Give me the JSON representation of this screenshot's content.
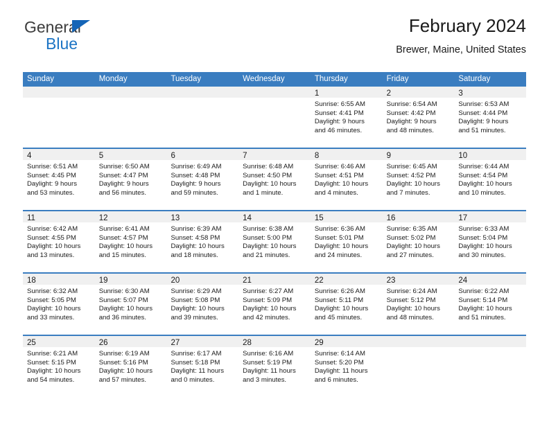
{
  "brand": {
    "name_primary": "General",
    "name_secondary": "Blue",
    "triangle_icon": "triangle-icon",
    "accent_color": "#1c74c4"
  },
  "header": {
    "title": "February 2024",
    "subtitle": "Brewer, Maine, United States"
  },
  "calendar": {
    "header_bg": "#3a7dc0",
    "day_head_bg": "#f0f0f0",
    "weekdays": [
      "Sunday",
      "Monday",
      "Tuesday",
      "Wednesday",
      "Thursday",
      "Friday",
      "Saturday"
    ],
    "weeks": [
      [
        {
          "day": "",
          "sunrise": "",
          "sunset": "",
          "daylight1": "",
          "daylight2": ""
        },
        {
          "day": "",
          "sunrise": "",
          "sunset": "",
          "daylight1": "",
          "daylight2": ""
        },
        {
          "day": "",
          "sunrise": "",
          "sunset": "",
          "daylight1": "",
          "daylight2": ""
        },
        {
          "day": "",
          "sunrise": "",
          "sunset": "",
          "daylight1": "",
          "daylight2": ""
        },
        {
          "day": "1",
          "sunrise": "Sunrise: 6:55 AM",
          "sunset": "Sunset: 4:41 PM",
          "daylight1": "Daylight: 9 hours",
          "daylight2": "and 46 minutes."
        },
        {
          "day": "2",
          "sunrise": "Sunrise: 6:54 AM",
          "sunset": "Sunset: 4:42 PM",
          "daylight1": "Daylight: 9 hours",
          "daylight2": "and 48 minutes."
        },
        {
          "day": "3",
          "sunrise": "Sunrise: 6:53 AM",
          "sunset": "Sunset: 4:44 PM",
          "daylight1": "Daylight: 9 hours",
          "daylight2": "and 51 minutes."
        }
      ],
      [
        {
          "day": "4",
          "sunrise": "Sunrise: 6:51 AM",
          "sunset": "Sunset: 4:45 PM",
          "daylight1": "Daylight: 9 hours",
          "daylight2": "and 53 minutes."
        },
        {
          "day": "5",
          "sunrise": "Sunrise: 6:50 AM",
          "sunset": "Sunset: 4:47 PM",
          "daylight1": "Daylight: 9 hours",
          "daylight2": "and 56 minutes."
        },
        {
          "day": "6",
          "sunrise": "Sunrise: 6:49 AM",
          "sunset": "Sunset: 4:48 PM",
          "daylight1": "Daylight: 9 hours",
          "daylight2": "and 59 minutes."
        },
        {
          "day": "7",
          "sunrise": "Sunrise: 6:48 AM",
          "sunset": "Sunset: 4:50 PM",
          "daylight1": "Daylight: 10 hours",
          "daylight2": "and 1 minute."
        },
        {
          "day": "8",
          "sunrise": "Sunrise: 6:46 AM",
          "sunset": "Sunset: 4:51 PM",
          "daylight1": "Daylight: 10 hours",
          "daylight2": "and 4 minutes."
        },
        {
          "day": "9",
          "sunrise": "Sunrise: 6:45 AM",
          "sunset": "Sunset: 4:52 PM",
          "daylight1": "Daylight: 10 hours",
          "daylight2": "and 7 minutes."
        },
        {
          "day": "10",
          "sunrise": "Sunrise: 6:44 AM",
          "sunset": "Sunset: 4:54 PM",
          "daylight1": "Daylight: 10 hours",
          "daylight2": "and 10 minutes."
        }
      ],
      [
        {
          "day": "11",
          "sunrise": "Sunrise: 6:42 AM",
          "sunset": "Sunset: 4:55 PM",
          "daylight1": "Daylight: 10 hours",
          "daylight2": "and 13 minutes."
        },
        {
          "day": "12",
          "sunrise": "Sunrise: 6:41 AM",
          "sunset": "Sunset: 4:57 PM",
          "daylight1": "Daylight: 10 hours",
          "daylight2": "and 15 minutes."
        },
        {
          "day": "13",
          "sunrise": "Sunrise: 6:39 AM",
          "sunset": "Sunset: 4:58 PM",
          "daylight1": "Daylight: 10 hours",
          "daylight2": "and 18 minutes."
        },
        {
          "day": "14",
          "sunrise": "Sunrise: 6:38 AM",
          "sunset": "Sunset: 5:00 PM",
          "daylight1": "Daylight: 10 hours",
          "daylight2": "and 21 minutes."
        },
        {
          "day": "15",
          "sunrise": "Sunrise: 6:36 AM",
          "sunset": "Sunset: 5:01 PM",
          "daylight1": "Daylight: 10 hours",
          "daylight2": "and 24 minutes."
        },
        {
          "day": "16",
          "sunrise": "Sunrise: 6:35 AM",
          "sunset": "Sunset: 5:02 PM",
          "daylight1": "Daylight: 10 hours",
          "daylight2": "and 27 minutes."
        },
        {
          "day": "17",
          "sunrise": "Sunrise: 6:33 AM",
          "sunset": "Sunset: 5:04 PM",
          "daylight1": "Daylight: 10 hours",
          "daylight2": "and 30 minutes."
        }
      ],
      [
        {
          "day": "18",
          "sunrise": "Sunrise: 6:32 AM",
          "sunset": "Sunset: 5:05 PM",
          "daylight1": "Daylight: 10 hours",
          "daylight2": "and 33 minutes."
        },
        {
          "day": "19",
          "sunrise": "Sunrise: 6:30 AM",
          "sunset": "Sunset: 5:07 PM",
          "daylight1": "Daylight: 10 hours",
          "daylight2": "and 36 minutes."
        },
        {
          "day": "20",
          "sunrise": "Sunrise: 6:29 AM",
          "sunset": "Sunset: 5:08 PM",
          "daylight1": "Daylight: 10 hours",
          "daylight2": "and 39 minutes."
        },
        {
          "day": "21",
          "sunrise": "Sunrise: 6:27 AM",
          "sunset": "Sunset: 5:09 PM",
          "daylight1": "Daylight: 10 hours",
          "daylight2": "and 42 minutes."
        },
        {
          "day": "22",
          "sunrise": "Sunrise: 6:26 AM",
          "sunset": "Sunset: 5:11 PM",
          "daylight1": "Daylight: 10 hours",
          "daylight2": "and 45 minutes."
        },
        {
          "day": "23",
          "sunrise": "Sunrise: 6:24 AM",
          "sunset": "Sunset: 5:12 PM",
          "daylight1": "Daylight: 10 hours",
          "daylight2": "and 48 minutes."
        },
        {
          "day": "24",
          "sunrise": "Sunrise: 6:22 AM",
          "sunset": "Sunset: 5:14 PM",
          "daylight1": "Daylight: 10 hours",
          "daylight2": "and 51 minutes."
        }
      ],
      [
        {
          "day": "25",
          "sunrise": "Sunrise: 6:21 AM",
          "sunset": "Sunset: 5:15 PM",
          "daylight1": "Daylight: 10 hours",
          "daylight2": "and 54 minutes."
        },
        {
          "day": "26",
          "sunrise": "Sunrise: 6:19 AM",
          "sunset": "Sunset: 5:16 PM",
          "daylight1": "Daylight: 10 hours",
          "daylight2": "and 57 minutes."
        },
        {
          "day": "27",
          "sunrise": "Sunrise: 6:17 AM",
          "sunset": "Sunset: 5:18 PM",
          "daylight1": "Daylight: 11 hours",
          "daylight2": "and 0 minutes."
        },
        {
          "day": "28",
          "sunrise": "Sunrise: 6:16 AM",
          "sunset": "Sunset: 5:19 PM",
          "daylight1": "Daylight: 11 hours",
          "daylight2": "and 3 minutes."
        },
        {
          "day": "29",
          "sunrise": "Sunrise: 6:14 AM",
          "sunset": "Sunset: 5:20 PM",
          "daylight1": "Daylight: 11 hours",
          "daylight2": "and 6 minutes."
        },
        {
          "day": "",
          "sunrise": "",
          "sunset": "",
          "daylight1": "",
          "daylight2": ""
        },
        {
          "day": "",
          "sunrise": "",
          "sunset": "",
          "daylight1": "",
          "daylight2": ""
        }
      ]
    ]
  }
}
